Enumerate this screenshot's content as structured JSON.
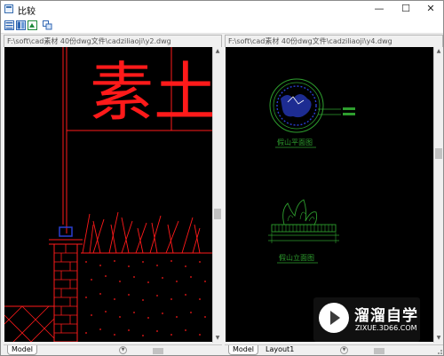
{
  "window": {
    "title": "比较",
    "minimize_glyph": "—",
    "maximize_glyph": "☐",
    "close_glyph": "✕"
  },
  "toolbar": {
    "buttons": [
      "layout-split-icon",
      "columns-icon",
      "export-icon",
      "compare-icon"
    ]
  },
  "left_pane": {
    "path": "F:\\soft\\cad素材 40份dwg文件\\cadziliaoji\\y2.dwg",
    "big_text": "素土",
    "tabs": [
      "Model"
    ]
  },
  "right_pane": {
    "path": "F:\\soft\\cad素材 40份dwg文件\\cadziliaoji\\y4.dwg",
    "plan_label": "假山平面图",
    "elevation_label": "假山立面图",
    "tabs": [
      "Model",
      "Layout1"
    ]
  },
  "watermark": {
    "brand": "溜溜自学",
    "url": "ZIXUE.3D66.COM"
  },
  "colors": {
    "cad_background": "#000000",
    "cad_red": "#ff1a1a",
    "cad_green": "#2e9e2e",
    "cad_blue": "#2a3fd0",
    "chrome": "#f0f0f0"
  }
}
